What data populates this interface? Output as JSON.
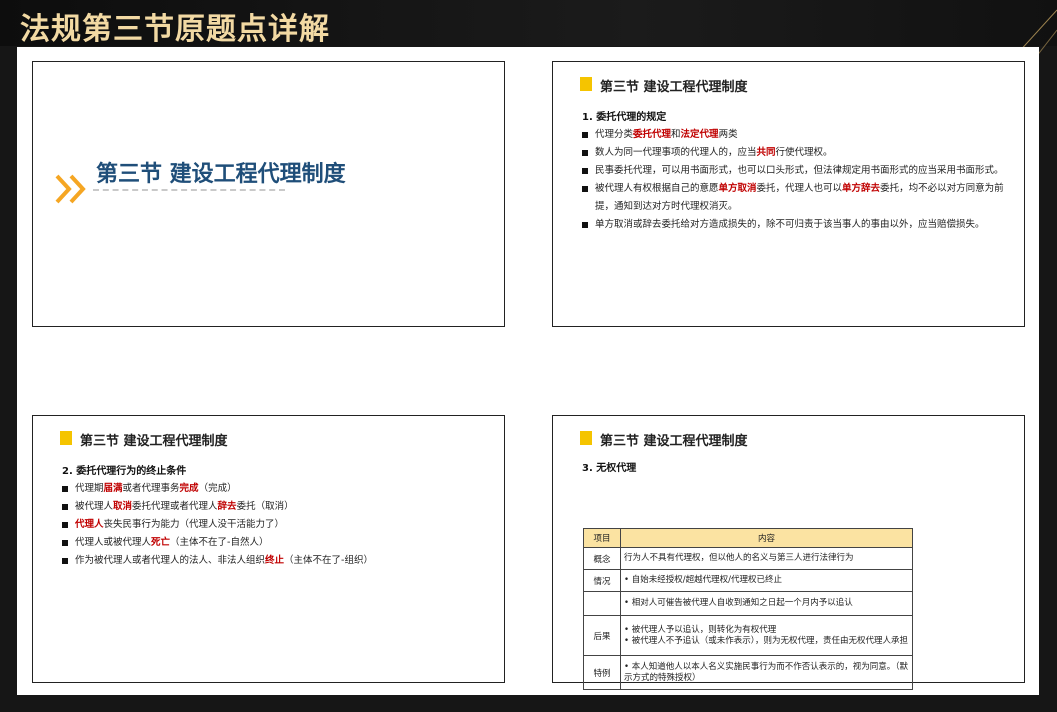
{
  "header": {
    "title": "法规第三节原题点详解"
  },
  "slide1": {
    "title": "第三节  建设工程代理制度"
  },
  "slide2": {
    "header": "第三节  建设工程代理制度",
    "subtitle": "1. 委托代理的规定",
    "bullets": [
      {
        "pre": "代理分类",
        "r1": "委托代理",
        "mid": "和",
        "r2": "法定代理",
        "post": "两类"
      },
      {
        "pre": "数人为同一代理事项的代理人的，应当",
        "r1": "共同",
        "post": "行使代理权。"
      },
      {
        "text": "民事委托代理，可以用书面形式，也可以口头形式，但法律规定用书面形式的应当采用书面形式。"
      },
      {
        "pre": "被代理人有权根据自己的意愿",
        "r1": "单方取消",
        "mid": "委托，代理人也可以",
        "r2": "单方辞去",
        "post": "委托，均不必以对方同意为前提，通知到达对方时代理权消灭。"
      },
      {
        "text": "单方取消或辞去委托给对方造成损失的，除不可归责于该当事人的事由以外，应当赔偿损失。"
      }
    ]
  },
  "slide3": {
    "header": "第三节  建设工程代理制度",
    "subtitle": "2. 委托代理行为的终止条件",
    "bullets": [
      {
        "pre": "代理期",
        "r1": "届满",
        "mid": "或者代理事务",
        "r2": "完成",
        "post": "（完成）"
      },
      {
        "pre": "被代理人",
        "r1": "取消",
        "mid": "委托代理或者代理人",
        "r2": "辞去",
        "post": "委托（取消）"
      },
      {
        "r1": "代理人",
        "post": "丧失民事行为能力（代理人没干活能力了）"
      },
      {
        "pre": "代理人或被代理人",
        "r1": "死亡",
        "post": "（主体不在了-自然人）"
      },
      {
        "pre": "作为被代理人或者代理人的法人、非法人组织",
        "r1": "终止",
        "post": "（主体不在了-组织）"
      }
    ]
  },
  "slide4": {
    "header": "第三节  建设工程代理制度",
    "subtitle": "3. 无权代理",
    "table": {
      "headers": [
        "项目",
        "内容"
      ],
      "rows": [
        {
          "key": "概念",
          "lines": [
            "行为人不具有代理权，但以他人的名义与第三人进行法律行为"
          ]
        },
        {
          "key": "情况",
          "lines": [
            "• 自始未经授权/超越代理权/代理权已终止"
          ]
        },
        {
          "key": "",
          "lines": [
            "• 相对人可催告被代理人自收到通知之日起一个月内予以追认"
          ]
        },
        {
          "key": "后果",
          "lines": [
            "• 被代理人予以追认，则转化为有权代理",
            "• 被代理人不予追认（或未作表示），则为无权代理，责任由无权代理人承担"
          ]
        },
        {
          "key": "特例",
          "lines": [
            "• 本人知道他人以本人名义实施民事行为而不作否认表示的，视为同意。（默示方式的特殊授权）"
          ]
        }
      ]
    }
  }
}
